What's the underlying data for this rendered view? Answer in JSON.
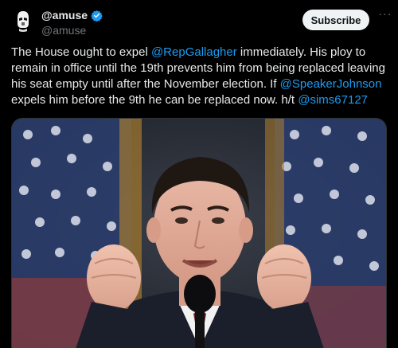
{
  "author": {
    "display_name": "@amuse",
    "handle": "@amuse",
    "verified": true,
    "avatar_icon": "stormtrooper-avatar"
  },
  "actions": {
    "subscribe_label": "Subscribe",
    "more_icon": "more-horizontal-icon"
  },
  "tweet": {
    "segments": [
      {
        "text": "The House ought to expel ",
        "type": "text"
      },
      {
        "text": "@RepGallagher",
        "type": "mention"
      },
      {
        "text": " immediately. His ploy to remain in office until the 19th prevents him from being replaced leaving his seat empty until after the November election. If ",
        "type": "text"
      },
      {
        "text": "@SpeakerJohnson",
        "type": "mention"
      },
      {
        "text": " expels him before the 9th he can be replaced now. h/t ",
        "type": "text"
      },
      {
        "text": "@sims67127",
        "type": "mention"
      }
    ]
  },
  "media": {
    "type": "photo"
  },
  "colors": {
    "background": "#000000",
    "text": "#e7e9ea",
    "secondary_text": "#71767b",
    "mention": "#1d9bf0",
    "verified": "#1d9bf0",
    "subscribe_bg": "#eff3f4"
  }
}
